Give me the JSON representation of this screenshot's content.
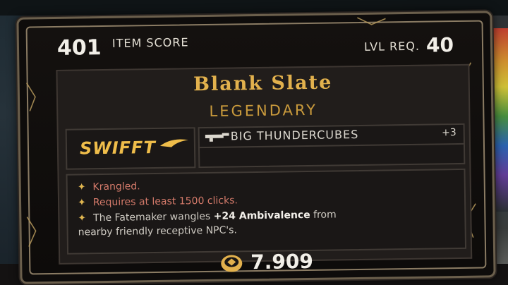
{
  "item": {
    "score_value": "401",
    "score_label": "ITEM SCORE",
    "level_label": "LVL REQ.",
    "level_value": "40",
    "name": "Blank Slate",
    "rarity": "LEGENDARY",
    "manufacturer": "SWIFFT",
    "weapon_name": "BIG THUNDERCUBES",
    "weapon_bonus": "+3",
    "traits": [
      {
        "text": "Krangled."
      },
      {
        "text": "Requires at least 1500 clicks."
      },
      {
        "prefix": "The Fatemaker wangles ",
        "highlight": "+24 Ambivalence",
        "suffix": " from",
        "line2": "nearby friendly receptive NPC's."
      }
    ],
    "price": "7.909"
  },
  "icons": {
    "trait_bullet": "star-icon",
    "weapon": "gun-icon",
    "currency": "coin-icon",
    "brand_mark": "swoosh-icon"
  },
  "colors": {
    "title_gold": "#e2b14d",
    "rarity_gold": "#c99a3c",
    "negative_trait": "#d47a6a",
    "neutral_trait": "#cfcbc3"
  }
}
